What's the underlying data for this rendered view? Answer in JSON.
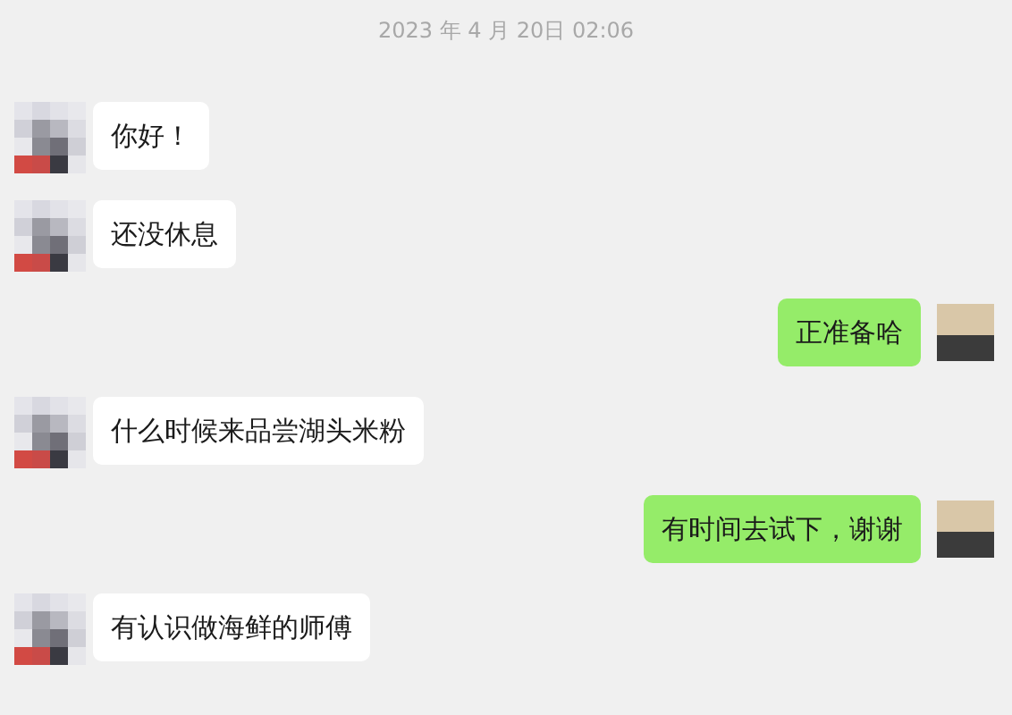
{
  "timestamp": "2023 年 4 月 20日 02:06",
  "messages": [
    {
      "kind": "received",
      "text": "你好！"
    },
    {
      "kind": "received",
      "text": "还没休息"
    },
    {
      "kind": "sent",
      "text": "正准备哈"
    },
    {
      "kind": "received",
      "text": "什么时候来品尝湖头米粉"
    },
    {
      "kind": "sent",
      "text": "有时间去试下，谢谢"
    },
    {
      "kind": "received",
      "text": "有认识做海鲜的师傅"
    }
  ]
}
